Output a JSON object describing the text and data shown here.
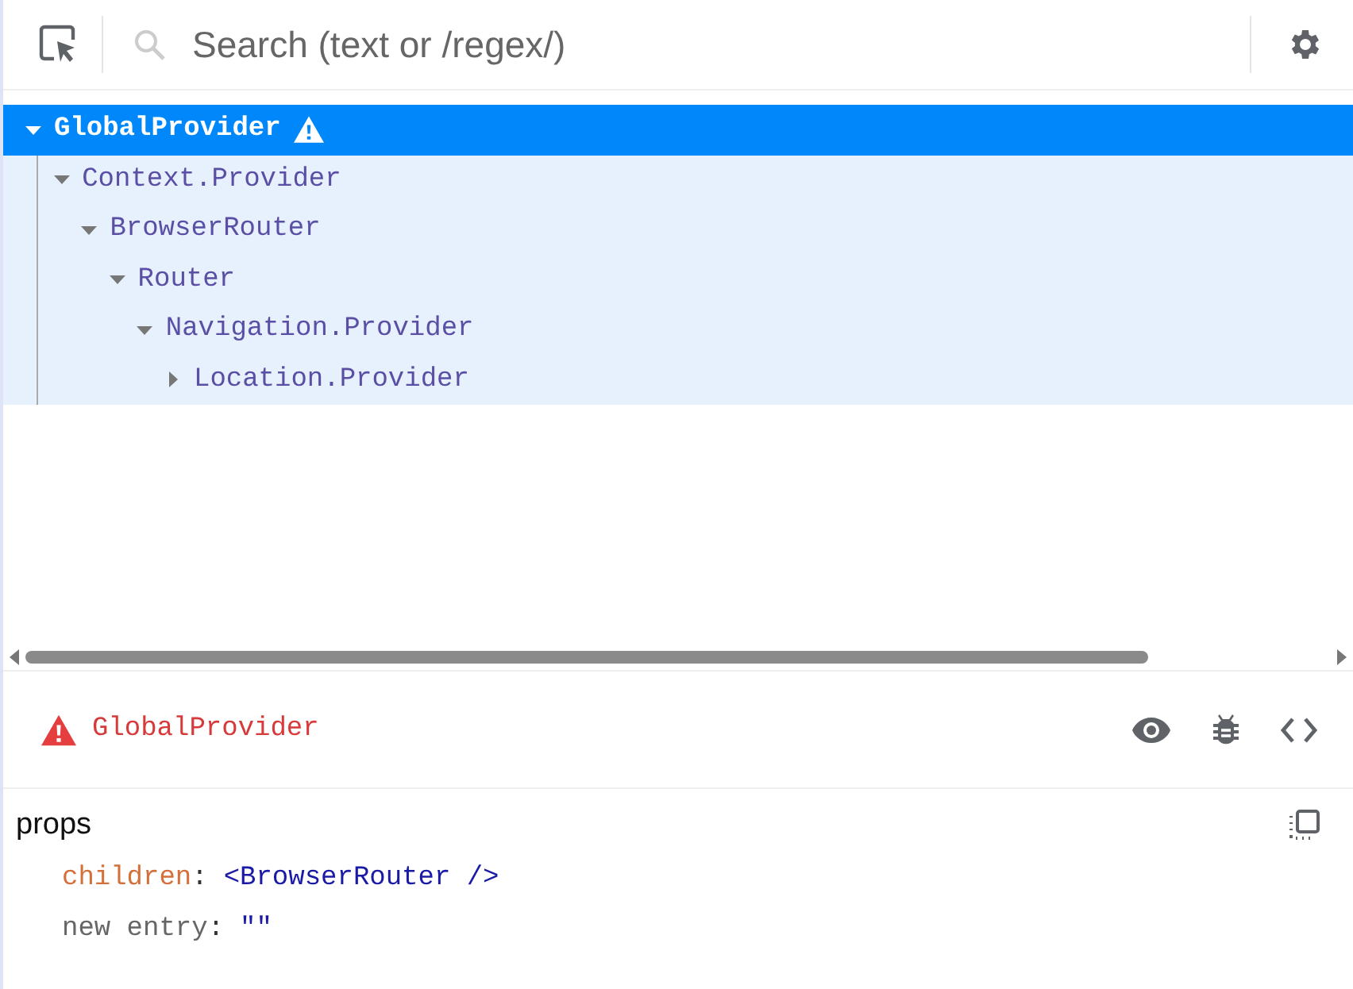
{
  "search": {
    "placeholder": "Search (text or /regex/)"
  },
  "tree": [
    {
      "name": "GlobalProvider",
      "warning": true,
      "expanded": true,
      "selected": true,
      "children": [
        {
          "name": "Context.Provider",
          "warning": false,
          "expanded": true,
          "selected": false,
          "children": [
            {
              "name": "BrowserRouter",
              "warning": false,
              "expanded": true,
              "selected": false,
              "children": [
                {
                  "name": "Router",
                  "warning": false,
                  "expanded": true,
                  "selected": false,
                  "children": [
                    {
                      "name": "Navigation.Provider",
                      "warning": false,
                      "expanded": true,
                      "selected": false,
                      "children": [
                        {
                          "name": "Location.Provider",
                          "warning": false,
                          "expanded": false,
                          "selected": false
                        }
                      ]
                    }
                  ]
                }
              ]
            }
          ]
        }
      ]
    }
  ],
  "details": {
    "component": "GlobalProvider",
    "warning": true
  },
  "props": {
    "title": "props",
    "entries": [
      {
        "kind": "prop",
        "key": "children",
        "separator": ":",
        "value": "<BrowserRouter />"
      },
      {
        "kind": "new",
        "key": "new entry",
        "separator": ":",
        "value": "\"\""
      }
    ]
  }
}
